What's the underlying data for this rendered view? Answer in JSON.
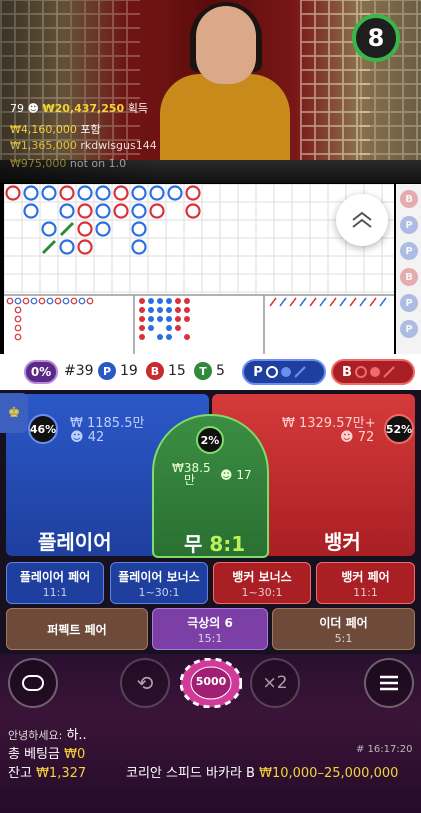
{
  "video": {
    "timer": "8",
    "players_count": "79",
    "total_won": "₩20,437,250",
    "total_won_suffix": "획득",
    "winners": [
      {
        "amount": "₩4,160,000",
        "name": "포함"
      },
      {
        "amount": "₩1,365,000",
        "name": "rkdwlsgus144"
      },
      {
        "amount": "₩975,000",
        "name": "not on 1.0"
      }
    ]
  },
  "stats": {
    "percent": "0%",
    "round": "#39",
    "player_letter": "P",
    "player_count": "19",
    "banker_letter": "B",
    "banker_count": "15",
    "tie_letter": "T",
    "tie_count": "5",
    "player_ask": "P",
    "banker_ask": "B"
  },
  "bets": {
    "player": {
      "label": "플레이어",
      "amount": "₩ 1185.5만",
      "users": "42",
      "percent": "46%"
    },
    "banker": {
      "label": "뱅커",
      "amount": "₩ 1329.57만+",
      "users": "72",
      "percent": "52%"
    },
    "tie": {
      "label": "무",
      "payout": "8:1",
      "amount_line1": "₩38.5",
      "amount_line2": "만",
      "users": "17",
      "percent": "2%"
    },
    "side": [
      {
        "label": "플레이어 페어",
        "payout": "11:1"
      },
      {
        "label": "플레이어 보너스",
        "payout": "1~30:1"
      },
      {
        "label": "뱅커 보너스",
        "payout": "1~30:1"
      },
      {
        "label": "뱅커 페어",
        "payout": "11:1"
      }
    ],
    "extra": [
      {
        "label": "퍼펙트 페어",
        "payout": ""
      },
      {
        "label": "극상의 6",
        "payout": "15:1"
      },
      {
        "label": "이더 페어",
        "payout": "5:1"
      }
    ]
  },
  "controls": {
    "chip_value": "5000",
    "double_label": "×2"
  },
  "footer": {
    "chat_user": "안녕하세요:",
    "chat_msg": "하..",
    "total_bet_label": "총 베팅금",
    "total_bet": "₩0",
    "balance_label": "잔고",
    "balance": "₩1,327",
    "game_id": "# 16:17:20",
    "table_name": "코리안 스피드 바카라 B",
    "limits": "₩10,000–25,000,000"
  },
  "colors": {
    "player": "#2b58c8",
    "banker": "#c92a2f",
    "tie": "#3b8e43",
    "accent_gold": "#f2d33a"
  },
  "roadmap": {
    "bead": [
      [
        "B",
        "P",
        "P",
        "B",
        "P",
        "P",
        "B",
        "P",
        "P",
        "P",
        "B"
      ],
      [
        "",
        "P",
        "",
        "P",
        "B",
        "P",
        "B",
        "P",
        "B",
        "",
        "B"
      ],
      [
        "",
        "",
        "P",
        "T",
        "B",
        "P",
        "",
        "P",
        "",
        "",
        ""
      ],
      [
        "",
        "",
        "T",
        "P",
        "B",
        "",
        "",
        "P",
        "",
        "",
        ""
      ]
    ]
  }
}
